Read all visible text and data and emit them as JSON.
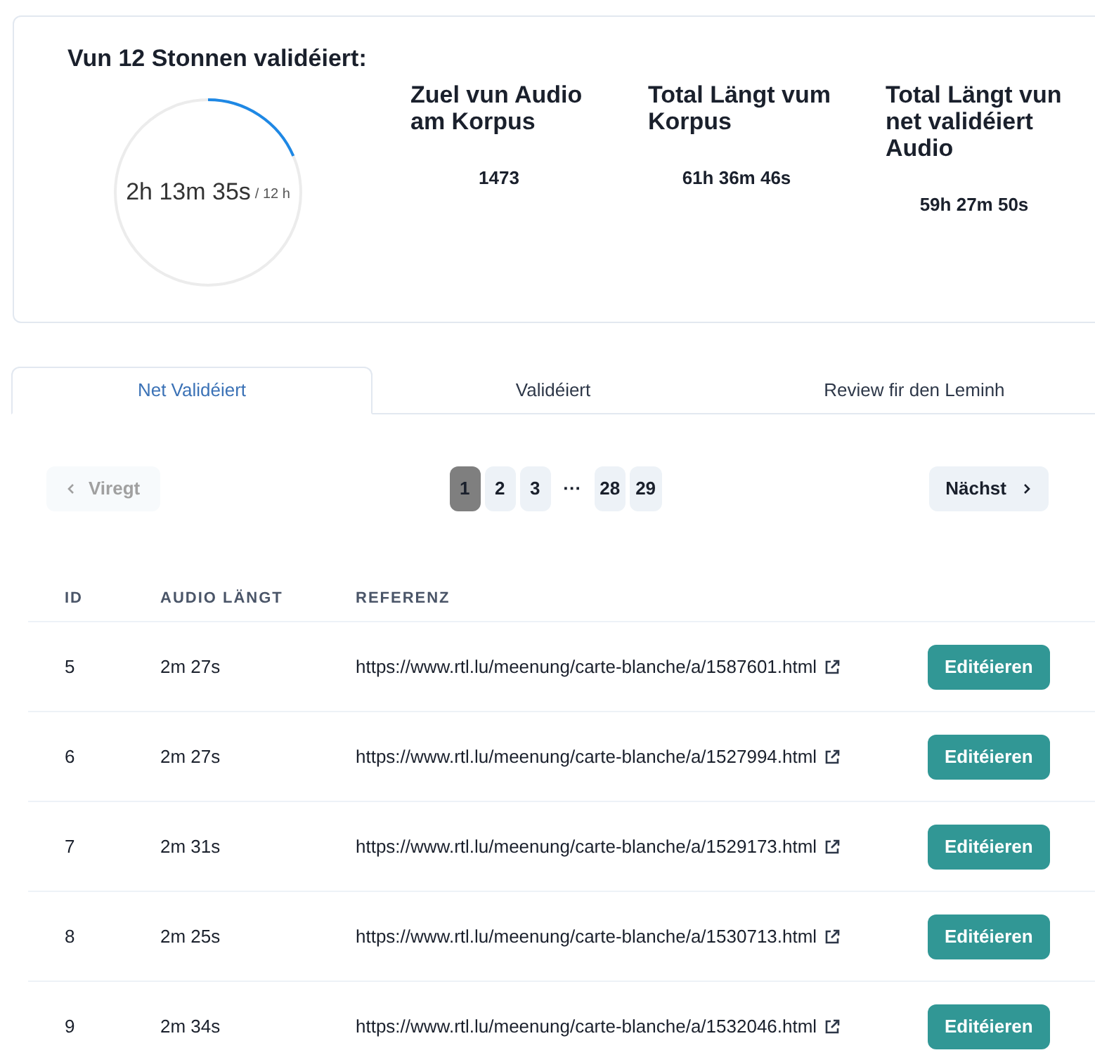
{
  "progress": {
    "title": "Vun 12 Stonnen validéiert:",
    "value": "2h 13m 35s",
    "total": "/ 12 h",
    "level": 0.1855
  },
  "stats": [
    {
      "label": "Zuel vun Audio am Korpus",
      "value": "1473"
    },
    {
      "label": "Total Längt vum Korpus",
      "value": "61h 36m 46s"
    },
    {
      "label": "Total Längt vun net validéiert Audio",
      "value": "59h 27m 50s"
    }
  ],
  "tabs": [
    {
      "label": "Net Validéiert",
      "selected": true
    },
    {
      "label": "Validéiert",
      "selected": false
    },
    {
      "label": "Review fir den Leminh",
      "selected": false
    }
  ],
  "pagination": {
    "previous": {
      "label": "Viregt",
      "disabled": true
    },
    "next": {
      "label": "Nächst",
      "disabled": false
    },
    "pages": [
      {
        "label": "1",
        "kind": "page",
        "selected": true
      },
      {
        "label": "2",
        "kind": "page",
        "selected": false
      },
      {
        "label": "3",
        "kind": "page",
        "selected": false
      },
      {
        "label": "···",
        "kind": "ellipsis"
      },
      {
        "label": "28",
        "kind": "page",
        "selected": false
      },
      {
        "label": "29",
        "kind": "page",
        "selected": false
      }
    ]
  },
  "table": {
    "columns": [
      "ID",
      "AUDIO LÄNGT",
      "REFERENZ"
    ],
    "rows": [
      {
        "id": "5",
        "length": "2m 27s",
        "reference": "https://www.rtl.lu/meenung/carte-blanche/a/1587601.html",
        "action": "Editéieren"
      },
      {
        "id": "6",
        "length": "2m 27s",
        "reference": "https://www.rtl.lu/meenung/carte-blanche/a/1527994.html",
        "action": "Editéieren"
      },
      {
        "id": "7",
        "length": "2m 31s",
        "reference": "https://www.rtl.lu/meenung/carte-blanche/a/1529173.html",
        "action": "Editéieren"
      },
      {
        "id": "8",
        "length": "2m 25s",
        "reference": "https://www.rtl.lu/meenung/carte-blanche/a/1530713.html",
        "action": "Editéieren"
      },
      {
        "id": "9",
        "length": "2m 34s",
        "reference": "https://www.rtl.lu/meenung/carte-blanche/a/1532046.html",
        "action": "Editéieren"
      }
    ]
  }
}
